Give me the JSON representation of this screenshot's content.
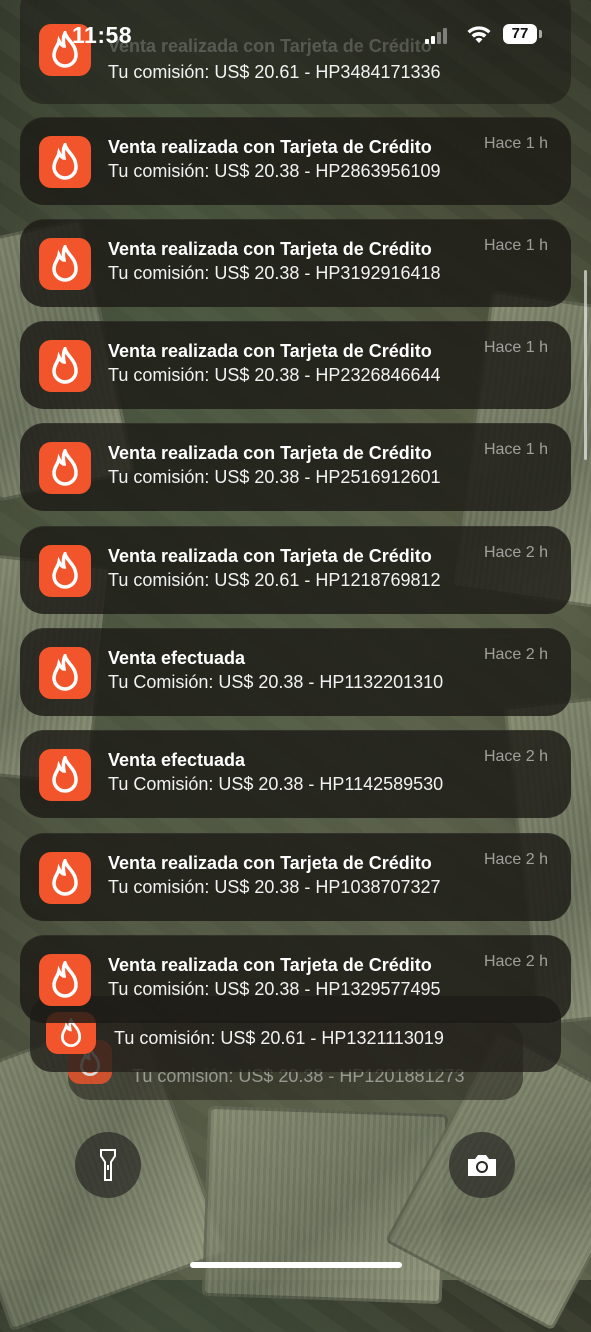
{
  "status_bar": {
    "time": "11:58",
    "battery": "77"
  },
  "app_icon_color": "#f2552c",
  "notifications": [
    {
      "title": "Venta realizada con Tarjeta de Crédito",
      "body": "Tu comisión: US$ 20.61 - HP3484171336",
      "time": ""
    },
    {
      "title": "Venta realizada con Tarjeta de Crédito",
      "body": "Tu comisión: US$ 20.38 - HP2863956109",
      "time": "Hace 1 h"
    },
    {
      "title": "Venta realizada con Tarjeta de Crédito",
      "body": "Tu comisión: US$ 20.38 - HP3192916418",
      "time": "Hace 1 h"
    },
    {
      "title": "Venta realizada con Tarjeta de Crédito",
      "body": "Tu comisión: US$ 20.38 - HP2326846644",
      "time": "Hace 1 h"
    },
    {
      "title": "Venta realizada con Tarjeta de Crédito",
      "body": "Tu comisión: US$ 20.38 - HP2516912601",
      "time": "Hace 1 h"
    },
    {
      "title": "Venta realizada con Tarjeta de Crédito",
      "body": "Tu comisión: US$ 20.61 - HP1218769812",
      "time": "Hace 2 h"
    },
    {
      "title": "Venta efectuada",
      "body": "Tu Comisión: US$ 20.38 - HP1132201310",
      "time": "Hace 2 h"
    },
    {
      "title": "Venta efectuada",
      "body": "Tu Comisión: US$ 20.38 - HP1142589530",
      "time": "Hace 2 h"
    },
    {
      "title": "Venta realizada con Tarjeta de Crédito",
      "body": "Tu comisión: US$ 20.38 - HP1038707327",
      "time": "Hace 2 h"
    },
    {
      "title": "Venta realizada con Tarjeta de Crédito",
      "body": "Tu comisión: US$ 20.38 - HP1329577495",
      "time": "Hace 2 h"
    }
  ],
  "stack": {
    "front_body": "Tu comisión: US$ 20.61 - HP1321113019",
    "back_body": "Tu comisión: US$ 20.38 - HP1201881273"
  },
  "icons": {
    "flashlight": "flashlight-icon",
    "camera": "camera-icon",
    "app": "flame-icon"
  }
}
